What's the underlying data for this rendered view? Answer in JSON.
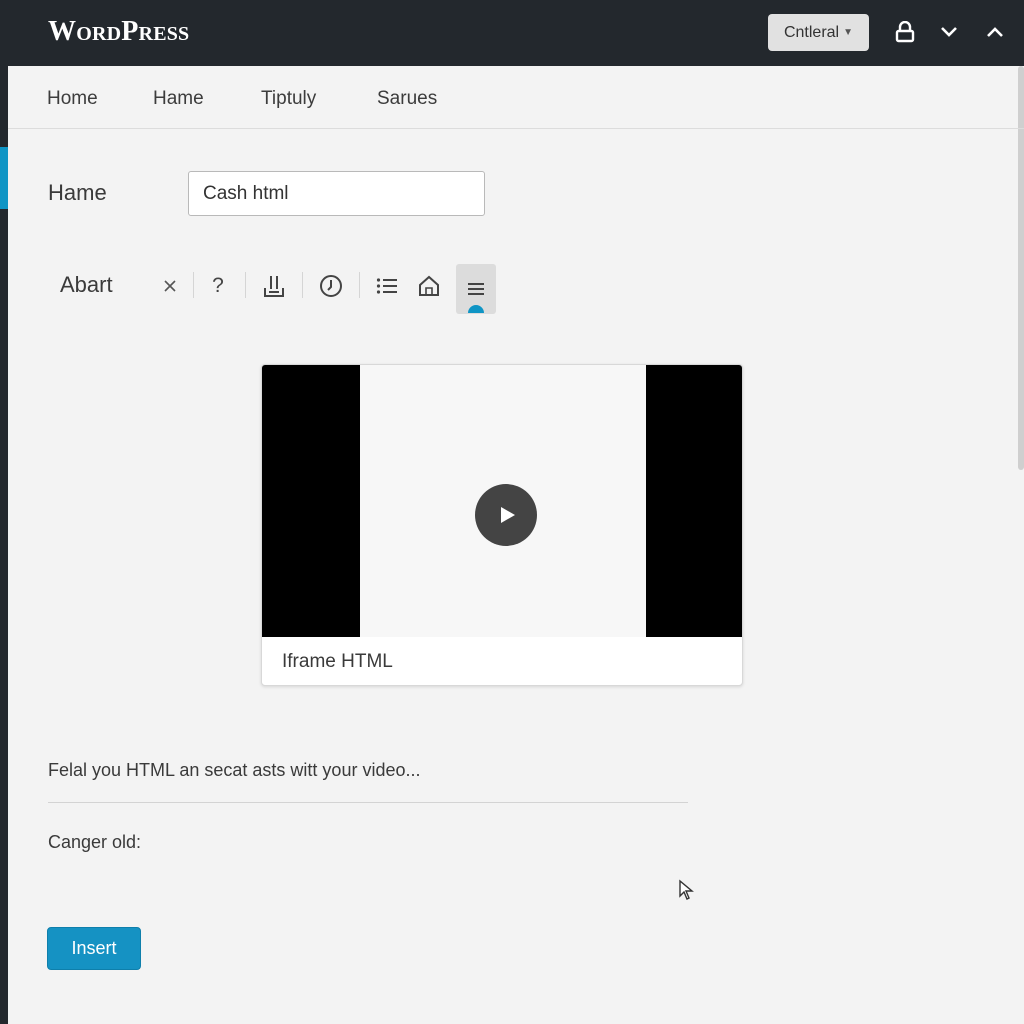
{
  "header": {
    "brand": "WordPress",
    "dropdown_label": "Cntleral",
    "icons": [
      "lock-icon",
      "chevron-down-icon",
      "chevron-up-icon"
    ]
  },
  "tabs": [
    {
      "label": "Home"
    },
    {
      "label": "Hame"
    },
    {
      "label": "Tiptuly"
    },
    {
      "label": "Sarues"
    }
  ],
  "form": {
    "name_label": "Hame",
    "name_value": "Cash html"
  },
  "toolbar": {
    "label": "Abart",
    "buttons": [
      "close-icon",
      "help-icon",
      "download-icon",
      "clock-icon",
      "list-icon",
      "house-icon",
      "menu-icon"
    ],
    "active_button": "menu-icon"
  },
  "video": {
    "caption": "Iframe HTML"
  },
  "description": "Felal you HTML an secat asts witt your video...",
  "changer_label": "Canger old:",
  "insert_label": "Insert",
  "colors": {
    "topbar": "#23282d",
    "accent": "#0f95c5",
    "button": "#1592c3"
  }
}
